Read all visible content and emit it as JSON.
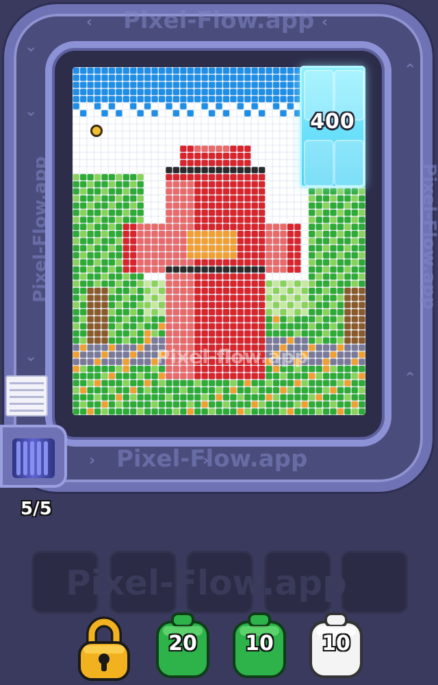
{
  "app": {
    "watermark": "Pixel-Flow.app",
    "board_watermark": "Pixel-flow.app"
  },
  "score": {
    "value": "400"
  },
  "queue": {
    "counter": "5/5"
  },
  "slots": {
    "count": 5,
    "watermark": "Pixel-Flow.app"
  },
  "shooters": [
    {
      "type": "locked",
      "label": "",
      "color": "#f2b21f",
      "icon": "lock-icon"
    },
    {
      "type": "blob",
      "label": "20",
      "color": "#2db34a",
      "icon": "green-blob-icon"
    },
    {
      "type": "blob",
      "label": "10",
      "color": "#2db34a",
      "icon": "green-blob-icon"
    },
    {
      "type": "blob",
      "label": "10",
      "color": "#f4f4f4",
      "icon": "white-blob-icon"
    }
  ],
  "palette": {
    "sky": "#1f8ee6",
    "cloud": "#ffffff",
    "red": "#d8252b",
    "pink": "#e86a6a",
    "orange": "#f0a030",
    "dark": "#2a2a2a",
    "green": "#2eaa36",
    "light_green": "#8ad35a",
    "pale_green": "#c6e8a0",
    "trunk": "#8a5a2a",
    "path": "#7a7a98"
  }
}
